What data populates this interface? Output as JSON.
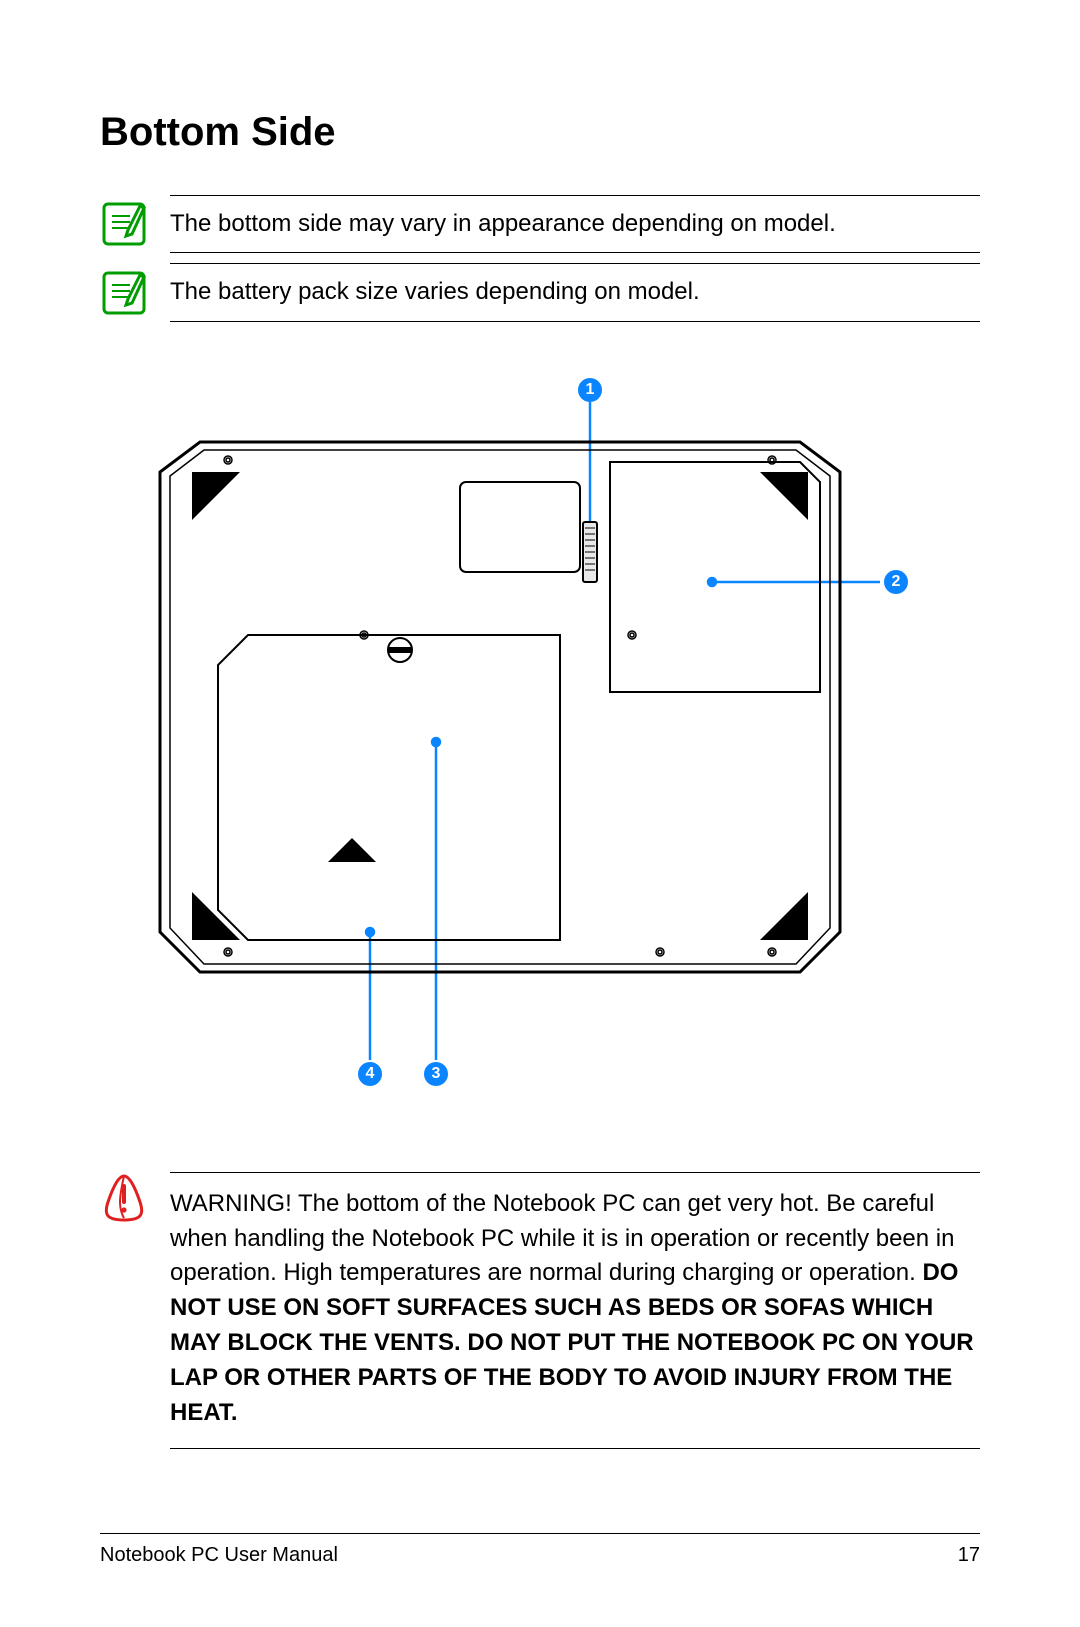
{
  "title": "Bottom Side",
  "notes": [
    "The bottom side may vary in appearance depending on model.",
    "The battery pack size varies depending on model."
  ],
  "callouts": [
    "1",
    "2",
    "3",
    "4"
  ],
  "warning": {
    "normal": "WARNING!  The bottom of the Notebook PC can get very hot. Be careful when handling the Notebook PC while it is in operation or recently been in operation. High temperatures are normal during charging or operation. ",
    "bold": "DO NOT USE ON SOFT SURFACES SUCH AS BEDS OR SOFAS WHICH MAY BLOCK THE VENTS. DO NOT PUT THE NOTEBOOK PC ON YOUR LAP OR OTHER PARTS OF THE BODY TO AVOID INJURY FROM THE HEAT."
  },
  "footer": {
    "left": "Notebook PC User Manual",
    "right": "17"
  }
}
